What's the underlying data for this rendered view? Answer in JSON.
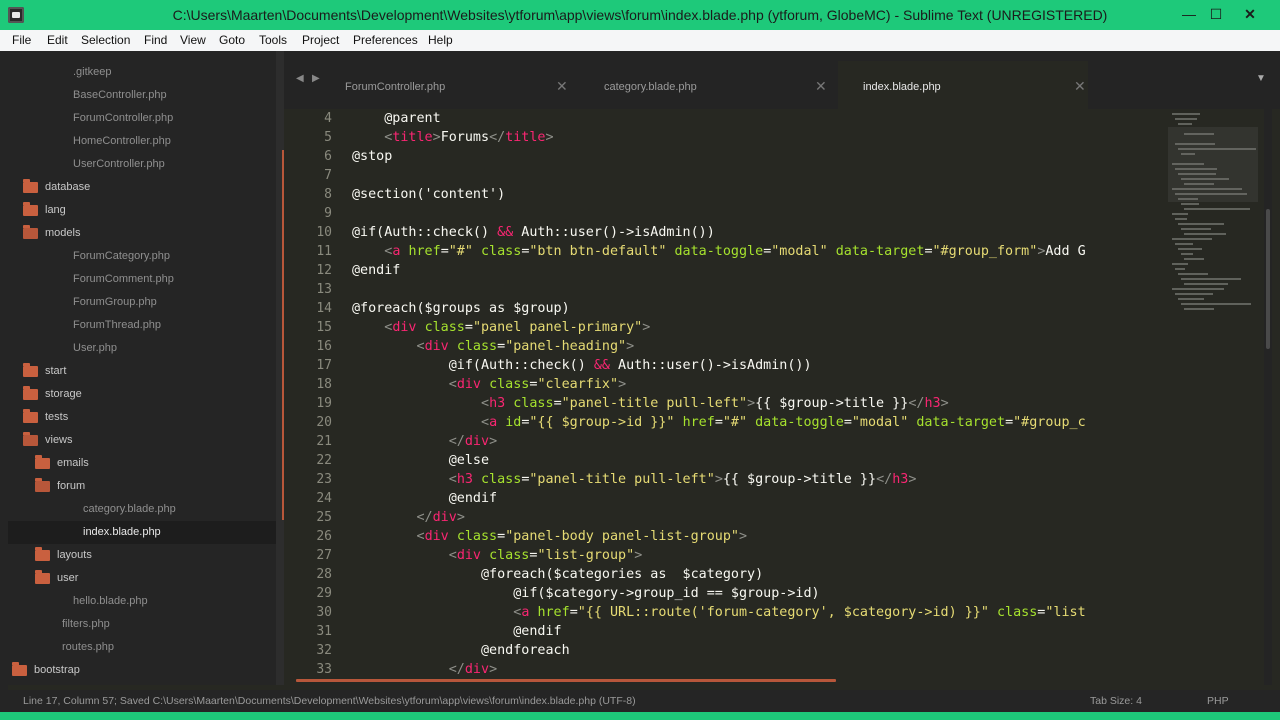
{
  "window": {
    "title": "C:\\Users\\Maarten\\Documents\\Development\\Websites\\ytforum\\app\\views\\forum\\index.blade.php (ytforum, GlobeMC) - Sublime Text (UNREGISTERED)",
    "minimize_glyph": "—",
    "maximize_glyph": "☐",
    "close_glyph": "✕"
  },
  "menu": [
    "File",
    "Edit",
    "Selection",
    "Find",
    "View",
    "Goto",
    "Tools",
    "Project",
    "Preferences",
    "Help"
  ],
  "sidebar": {
    "items": [
      {
        "label": ".gitkeep",
        "type": "file",
        "depth": 2
      },
      {
        "label": "BaseController.php",
        "type": "file",
        "depth": 2
      },
      {
        "label": "ForumController.php",
        "type": "file",
        "depth": 2
      },
      {
        "label": "HomeController.php",
        "type": "file",
        "depth": 2
      },
      {
        "label": "UserController.php",
        "type": "file",
        "depth": 2
      },
      {
        "label": "database",
        "type": "folder",
        "depth": 1
      },
      {
        "label": "lang",
        "type": "folder",
        "depth": 1
      },
      {
        "label": "models",
        "type": "folder-open",
        "depth": 1
      },
      {
        "label": "ForumCategory.php",
        "type": "file",
        "depth": 2
      },
      {
        "label": "ForumComment.php",
        "type": "file",
        "depth": 2
      },
      {
        "label": "ForumGroup.php",
        "type": "file",
        "depth": 2
      },
      {
        "label": "ForumThread.php",
        "type": "file",
        "depth": 2
      },
      {
        "label": "User.php",
        "type": "file",
        "depth": 2
      },
      {
        "label": "start",
        "type": "folder",
        "depth": 1
      },
      {
        "label": "storage",
        "type": "folder",
        "depth": 1
      },
      {
        "label": "tests",
        "type": "folder",
        "depth": 1
      },
      {
        "label": "views",
        "type": "folder-open",
        "depth": 1
      },
      {
        "label": "emails",
        "type": "folder",
        "depth": 2
      },
      {
        "label": "forum",
        "type": "folder-open",
        "depth": 2
      },
      {
        "label": "category.blade.php",
        "type": "file",
        "depth": 3
      },
      {
        "label": "index.blade.php",
        "type": "file",
        "depth": 3,
        "selected": true
      },
      {
        "label": "layouts",
        "type": "folder",
        "depth": 2
      },
      {
        "label": "user",
        "type": "folder",
        "depth": 2
      },
      {
        "label": "hello.blade.php",
        "type": "file",
        "depth": 2
      },
      {
        "label": "filters.php",
        "type": "file",
        "depth": 1
      },
      {
        "label": "routes.php",
        "type": "file",
        "depth": 1
      },
      {
        "label": "bootstrap",
        "type": "folder",
        "depth": 0
      }
    ]
  },
  "tabs": [
    {
      "label": "ForumController.php",
      "active": false
    },
    {
      "label": "category.blade.php",
      "active": false
    },
    {
      "label": "index.blade.php",
      "active": true
    }
  ],
  "tab_close_glyph": "✕",
  "editor": {
    "lines": [
      {
        "n": "4",
        "tokens": [
          [
            "t",
            "    @parent"
          ]
        ]
      },
      {
        "n": "5",
        "tokens": [
          [
            "t",
            "    "
          ],
          [
            "p",
            "<"
          ],
          [
            "k",
            "title"
          ],
          [
            "p",
            ">"
          ],
          [
            "t",
            "Forums"
          ],
          [
            "p",
            "</"
          ],
          [
            "k",
            "title"
          ],
          [
            "p",
            ">"
          ]
        ]
      },
      {
        "n": "6",
        "tokens": [
          [
            "t",
            "@stop"
          ]
        ]
      },
      {
        "n": "7",
        "tokens": []
      },
      {
        "n": "8",
        "tokens": [
          [
            "t",
            "@section('content')"
          ]
        ]
      },
      {
        "n": "9",
        "tokens": []
      },
      {
        "n": "10",
        "tokens": [
          [
            "t",
            "@if(Auth::check() "
          ],
          [
            "k",
            "&&"
          ],
          [
            "t",
            " Auth::user()->isAdmin())"
          ]
        ]
      },
      {
        "n": "11",
        "tokens": [
          [
            "t",
            "    "
          ],
          [
            "p",
            "<"
          ],
          [
            "k",
            "a"
          ],
          [
            "t",
            " "
          ],
          [
            "g",
            "href"
          ],
          [
            "t",
            "="
          ],
          [
            "y",
            "\"#\""
          ],
          [
            "t",
            " "
          ],
          [
            "g",
            "class"
          ],
          [
            "t",
            "="
          ],
          [
            "y",
            "\"btn btn-default\""
          ],
          [
            "t",
            " "
          ],
          [
            "g",
            "data-toggle"
          ],
          [
            "t",
            "="
          ],
          [
            "y",
            "\"modal\""
          ],
          [
            "t",
            " "
          ],
          [
            "g",
            "data-target"
          ],
          [
            "t",
            "="
          ],
          [
            "y",
            "\"#group_form\""
          ],
          [
            "p",
            ">"
          ],
          [
            "t",
            "Add G"
          ]
        ]
      },
      {
        "n": "12",
        "tokens": [
          [
            "t",
            "@endif"
          ]
        ]
      },
      {
        "n": "13",
        "tokens": []
      },
      {
        "n": "14",
        "tokens": [
          [
            "t",
            "@foreach($groups as $group)"
          ]
        ]
      },
      {
        "n": "15",
        "tokens": [
          [
            "t",
            "    "
          ],
          [
            "p",
            "<"
          ],
          [
            "k",
            "div"
          ],
          [
            "t",
            " "
          ],
          [
            "g",
            "class"
          ],
          [
            "t",
            "="
          ],
          [
            "y",
            "\"panel panel-primary\""
          ],
          [
            "p",
            ">"
          ]
        ]
      },
      {
        "n": "16",
        "tokens": [
          [
            "t",
            "        "
          ],
          [
            "p",
            "<"
          ],
          [
            "k",
            "div"
          ],
          [
            "t",
            " "
          ],
          [
            "g",
            "class"
          ],
          [
            "t",
            "="
          ],
          [
            "y",
            "\"panel-heading\""
          ],
          [
            "p",
            ">"
          ]
        ]
      },
      {
        "n": "17",
        "tokens": [
          [
            "t",
            "            @if(Auth::check() "
          ],
          [
            "k",
            "&&"
          ],
          [
            "t",
            " Auth::user()->isAdmin())"
          ]
        ]
      },
      {
        "n": "18",
        "tokens": [
          [
            "t",
            "            "
          ],
          [
            "p",
            "<"
          ],
          [
            "k",
            "div"
          ],
          [
            "t",
            " "
          ],
          [
            "g",
            "class"
          ],
          [
            "t",
            "="
          ],
          [
            "y",
            "\"clearfix\""
          ],
          [
            "p",
            ">"
          ]
        ]
      },
      {
        "n": "19",
        "tokens": [
          [
            "t",
            "                "
          ],
          [
            "p",
            "<"
          ],
          [
            "k",
            "h3"
          ],
          [
            "t",
            " "
          ],
          [
            "g",
            "class"
          ],
          [
            "t",
            "="
          ],
          [
            "y",
            "\"panel-title pull-left\""
          ],
          [
            "p",
            ">"
          ],
          [
            "t",
            "{{ $group->title }}"
          ],
          [
            "p",
            "</"
          ],
          [
            "k",
            "h3"
          ],
          [
            "p",
            ">"
          ]
        ]
      },
      {
        "n": "20",
        "tokens": [
          [
            "t",
            "                "
          ],
          [
            "p",
            "<"
          ],
          [
            "k",
            "a"
          ],
          [
            "t",
            " "
          ],
          [
            "g",
            "id"
          ],
          [
            "t",
            "="
          ],
          [
            "y",
            "\"{{ $group->id }}\""
          ],
          [
            "t",
            " "
          ],
          [
            "g",
            "href"
          ],
          [
            "t",
            "="
          ],
          [
            "y",
            "\"#\""
          ],
          [
            "t",
            " "
          ],
          [
            "g",
            "data-toggle"
          ],
          [
            "t",
            "="
          ],
          [
            "y",
            "\"modal\""
          ],
          [
            "t",
            " "
          ],
          [
            "g",
            "data-target"
          ],
          [
            "t",
            "="
          ],
          [
            "y",
            "\"#group_c"
          ]
        ]
      },
      {
        "n": "21",
        "tokens": [
          [
            "t",
            "            "
          ],
          [
            "p",
            "</"
          ],
          [
            "k",
            "div"
          ],
          [
            "p",
            ">"
          ]
        ]
      },
      {
        "n": "22",
        "tokens": [
          [
            "t",
            "            @else"
          ]
        ]
      },
      {
        "n": "23",
        "tokens": [
          [
            "t",
            "            "
          ],
          [
            "p",
            "<"
          ],
          [
            "k",
            "h3"
          ],
          [
            "t",
            " "
          ],
          [
            "g",
            "class"
          ],
          [
            "t",
            "="
          ],
          [
            "y",
            "\"panel-title pull-left\""
          ],
          [
            "p",
            ">"
          ],
          [
            "t",
            "{{ $group->title }}"
          ],
          [
            "p",
            "</"
          ],
          [
            "k",
            "h3"
          ],
          [
            "p",
            ">"
          ]
        ]
      },
      {
        "n": "24",
        "tokens": [
          [
            "t",
            "            @endif"
          ]
        ]
      },
      {
        "n": "25",
        "tokens": [
          [
            "t",
            "        "
          ],
          [
            "p",
            "</"
          ],
          [
            "k",
            "div"
          ],
          [
            "p",
            ">"
          ]
        ]
      },
      {
        "n": "26",
        "tokens": [
          [
            "t",
            "        "
          ],
          [
            "p",
            "<"
          ],
          [
            "k",
            "div"
          ],
          [
            "t",
            " "
          ],
          [
            "g",
            "class"
          ],
          [
            "t",
            "="
          ],
          [
            "y",
            "\"panel-body panel-list-group\""
          ],
          [
            "p",
            ">"
          ]
        ]
      },
      {
        "n": "27",
        "tokens": [
          [
            "t",
            "            "
          ],
          [
            "p",
            "<"
          ],
          [
            "k",
            "div"
          ],
          [
            "t",
            " "
          ],
          [
            "g",
            "class"
          ],
          [
            "t",
            "="
          ],
          [
            "y",
            "\"list-group\""
          ],
          [
            "p",
            ">"
          ]
        ]
      },
      {
        "n": "28",
        "tokens": [
          [
            "t",
            "                @foreach($categories as  $category)"
          ]
        ]
      },
      {
        "n": "29",
        "tokens": [
          [
            "t",
            "                    @if($category->group_id == $group->id)"
          ]
        ]
      },
      {
        "n": "30",
        "tokens": [
          [
            "t",
            "                    "
          ],
          [
            "p",
            "<"
          ],
          [
            "k",
            "a"
          ],
          [
            "t",
            " "
          ],
          [
            "g",
            "href"
          ],
          [
            "t",
            "="
          ],
          [
            "y",
            "\"{{ URL::route('forum-category', $category->id) }}\""
          ],
          [
            "t",
            " "
          ],
          [
            "g",
            "class"
          ],
          [
            "t",
            "="
          ],
          [
            "y",
            "\"list"
          ]
        ]
      },
      {
        "n": "31",
        "tokens": [
          [
            "t",
            "                    @endif"
          ]
        ]
      },
      {
        "n": "32",
        "tokens": [
          [
            "t",
            "                @endforeach"
          ]
        ]
      },
      {
        "n": "33",
        "tokens": [
          [
            "t",
            "            "
          ],
          [
            "p",
            "</"
          ],
          [
            "k",
            "div"
          ],
          [
            "p",
            ">"
          ]
        ]
      }
    ]
  },
  "status": {
    "left": "Line 17, Column 57; Saved C:\\Users\\Maarten\\Documents\\Development\\Websites\\ytforum\\app\\views\\forum\\index.blade.php (UTF-8)",
    "tab_size": "Tab Size: 4",
    "syntax": "PHP"
  },
  "colors": {
    "titlebar": "#1ec97a",
    "editor_bg": "#272822",
    "sidebar_bg": "#252525",
    "folder": "#c9603f",
    "keyword": "#f92672",
    "attribute": "#a6e22e",
    "string": "#e6db74"
  }
}
